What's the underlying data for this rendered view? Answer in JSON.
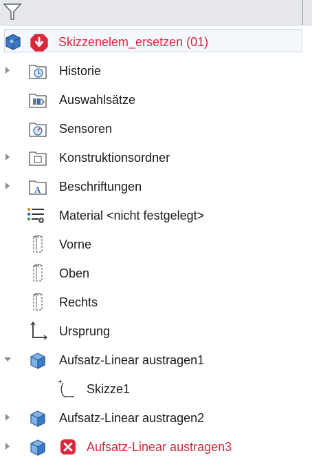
{
  "tree": {
    "root": {
      "label": "Skizzenelem_ersetzen (01)",
      "has_error": true
    },
    "items": [
      {
        "label": "Historie",
        "icon": "history-folder-icon",
        "expandable": true,
        "expanded": false
      },
      {
        "label": "Auswahlsätze",
        "icon": "selection-sets-folder-icon",
        "expandable": false
      },
      {
        "label": "Sensoren",
        "icon": "sensors-folder-icon",
        "expandable": false
      },
      {
        "label": "Konstruktionsordner",
        "icon": "design-folder-icon",
        "expandable": true,
        "expanded": false
      },
      {
        "label": "Beschriftungen",
        "icon": "annotations-folder-icon",
        "expandable": true,
        "expanded": false
      },
      {
        "label": "Material <nicht festgelegt>",
        "icon": "material-icon",
        "expandable": false
      },
      {
        "label": "Vorne",
        "icon": "plane-icon",
        "expandable": false
      },
      {
        "label": "Oben",
        "icon": "plane-icon",
        "expandable": false
      },
      {
        "label": "Rechts",
        "icon": "plane-icon",
        "expandable": false
      },
      {
        "label": "Ursprung",
        "icon": "origin-icon",
        "expandable": false
      },
      {
        "label": "Aufsatz-Linear austragen1",
        "icon": "extrude-feature-icon",
        "expandable": true,
        "expanded": true
      },
      {
        "label": "Skizze1",
        "icon": "sketch-icon",
        "expandable": false
      },
      {
        "label": "Aufsatz-Linear austragen2",
        "icon": "extrude-feature-icon",
        "expandable": true,
        "expanded": false
      },
      {
        "label": "Aufsatz-Linear austragen3",
        "icon": "extrude-feature-icon",
        "expandable": true,
        "expanded": false,
        "has_error": true
      }
    ]
  },
  "colors": {
    "error": "#d4283c",
    "part_blue": "#2f6db3"
  }
}
